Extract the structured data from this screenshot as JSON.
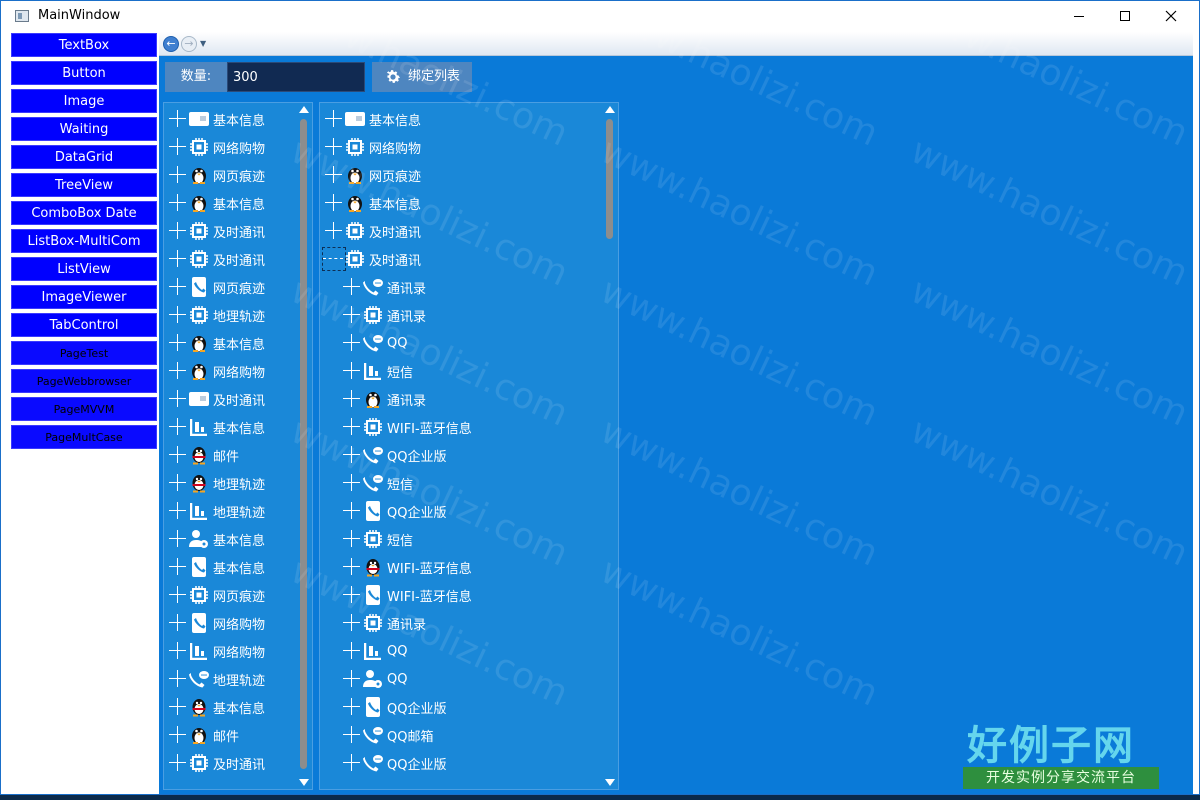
{
  "window": {
    "title": "MainWindow"
  },
  "menu": [
    {
      "label": "TextBox"
    },
    {
      "label": "Button"
    },
    {
      "label": "Image"
    },
    {
      "label": "Waiting"
    },
    {
      "label": "DataGrid"
    },
    {
      "label": "TreeView"
    },
    {
      "label": "ComboBox Date"
    },
    {
      "label": "ListBox-MultiCom"
    },
    {
      "label": "ListView"
    },
    {
      "label": "ImageViewer"
    },
    {
      "label": "TabControl"
    },
    {
      "label": "PageTest"
    },
    {
      "label": "PageWebbrowser"
    },
    {
      "label": "PageMVVM"
    },
    {
      "label": "PageMultCase"
    }
  ],
  "toolbar": {
    "qty_label": "数量:",
    "qty_value": "300",
    "bind_label": "绑定列表"
  },
  "tree1": [
    {
      "icon": "card",
      "label": "基本信息"
    },
    {
      "icon": "chip",
      "label": "网络购物"
    },
    {
      "icon": "penguin",
      "label": "网页痕迹"
    },
    {
      "icon": "penguin",
      "label": "基本信息"
    },
    {
      "icon": "chip",
      "label": "及时通讯"
    },
    {
      "icon": "chip",
      "label": "及时通讯"
    },
    {
      "icon": "phonebook",
      "label": "网页痕迹"
    },
    {
      "icon": "chip",
      "label": "地理轨迹"
    },
    {
      "icon": "penguin",
      "label": "基本信息"
    },
    {
      "icon": "penguin",
      "label": "网络购物"
    },
    {
      "icon": "card",
      "label": "及时通讯"
    },
    {
      "icon": "chart",
      "label": "基本信息"
    },
    {
      "icon": "qq",
      "label": "邮件"
    },
    {
      "icon": "qq",
      "label": "地理轨迹"
    },
    {
      "icon": "chart",
      "label": "地理轨迹"
    },
    {
      "icon": "usergear",
      "label": "基本信息"
    },
    {
      "icon": "phonebook",
      "label": "基本信息"
    },
    {
      "icon": "chip",
      "label": "网页痕迹"
    },
    {
      "icon": "phonebook",
      "label": "网络购物"
    },
    {
      "icon": "chart",
      "label": "网络购物"
    },
    {
      "icon": "callbubble",
      "label": "地理轨迹"
    },
    {
      "icon": "qq",
      "label": "基本信息"
    },
    {
      "icon": "penguin",
      "label": "邮件"
    },
    {
      "icon": "chip",
      "label": "及时通讯"
    }
  ],
  "tree2": [
    {
      "indent": 0,
      "icon": "card",
      "label": "基本信息"
    },
    {
      "indent": 0,
      "icon": "chip",
      "label": "网络购物"
    },
    {
      "indent": 0,
      "icon": "penguin",
      "label": "网页痕迹"
    },
    {
      "indent": 0,
      "icon": "penguin",
      "label": "基本信息"
    },
    {
      "indent": 0,
      "icon": "chip",
      "label": "及时通讯"
    },
    {
      "indent": 0,
      "icon": "chip",
      "label": "及时通讯",
      "open": true
    },
    {
      "indent": 1,
      "icon": "callbubble",
      "label": "通讯录"
    },
    {
      "indent": 1,
      "icon": "chip",
      "label": "通讯录"
    },
    {
      "indent": 1,
      "icon": "callbubble",
      "label": "QQ"
    },
    {
      "indent": 1,
      "icon": "chart",
      "label": "短信"
    },
    {
      "indent": 1,
      "icon": "penguin",
      "label": "通讯录"
    },
    {
      "indent": 1,
      "icon": "chip",
      "label": "WIFI-蓝牙信息"
    },
    {
      "indent": 1,
      "icon": "callbubble",
      "label": "QQ企业版"
    },
    {
      "indent": 1,
      "icon": "callbubble",
      "label": "短信"
    },
    {
      "indent": 1,
      "icon": "phonebook",
      "label": "QQ企业版"
    },
    {
      "indent": 1,
      "icon": "chip",
      "label": "短信"
    },
    {
      "indent": 1,
      "icon": "qq",
      "label": "WIFI-蓝牙信息"
    },
    {
      "indent": 1,
      "icon": "phonebook",
      "label": "WIFI-蓝牙信息"
    },
    {
      "indent": 1,
      "icon": "chip",
      "label": "通讯录"
    },
    {
      "indent": 1,
      "icon": "chart",
      "label": "QQ"
    },
    {
      "indent": 1,
      "icon": "usergear",
      "label": "QQ"
    },
    {
      "indent": 1,
      "icon": "phonebook",
      "label": "QQ企业版"
    },
    {
      "indent": 1,
      "icon": "callbubble",
      "label": "QQ邮箱"
    },
    {
      "indent": 1,
      "icon": "callbubble",
      "label": "QQ企业版"
    }
  ],
  "watermark": "www.haolizi.com",
  "brand": {
    "title": "好例子网",
    "subtitle": "开发实例分享交流平台"
  },
  "colors": {
    "content_bg": "#0a7ad8",
    "menu_button": "#0000ff",
    "tree_bg": "#1a88d8"
  }
}
